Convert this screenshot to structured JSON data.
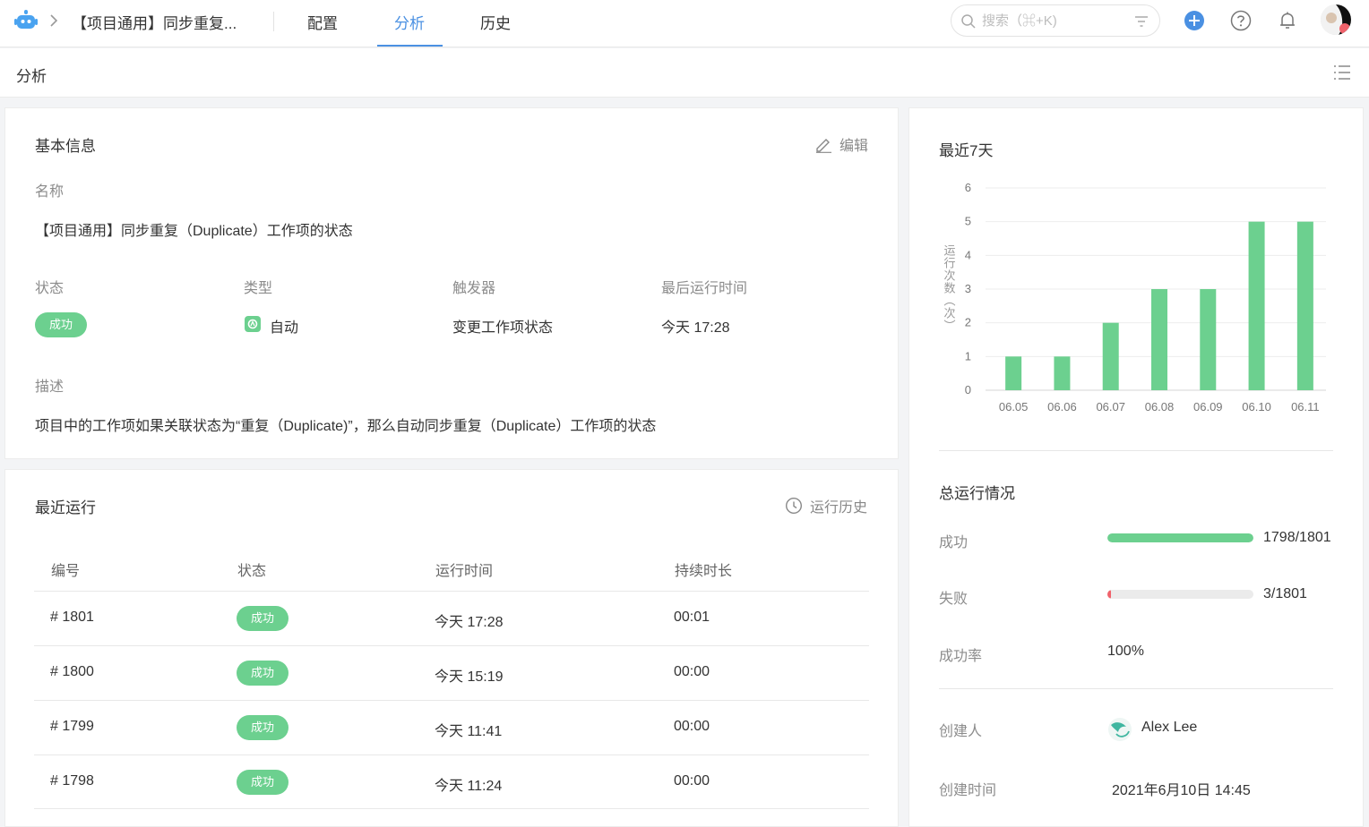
{
  "nav": {
    "project_title": "【项目通用】同步重复...",
    "tabs": [
      {
        "label": "配置"
      },
      {
        "label": "分析"
      },
      {
        "label": "历史"
      }
    ],
    "search_placeholder": "搜索（⌘+K)"
  },
  "subheader": {
    "title": "分析"
  },
  "basic_info": {
    "title": "基本信息",
    "edit_label": "编辑",
    "name_label": "名称",
    "name_value": "【项目通用】同步重复（Duplicate）工作项的状态",
    "status_label": "状态",
    "status_value": "成功",
    "type_label": "类型",
    "type_value": "自动",
    "trigger_label": "触发器",
    "trigger_value": "变更工作项状态",
    "last_run_label": "最后运行时间",
    "last_run_value": "今天 17:28",
    "desc_label": "描述",
    "desc_value": "项目中的工作项如果关联状态为“重复（Duplicate)”，那么自动同步重复（Duplicate）工作项的状态"
  },
  "recent_runs": {
    "title": "最近运行",
    "history_label": "运行历史",
    "columns": [
      "编号",
      "状态",
      "运行时间",
      "持续时长"
    ],
    "rows": [
      {
        "id": "# 1801",
        "status": "成功",
        "time": "今天 17:28",
        "duration": "00:01"
      },
      {
        "id": "# 1800",
        "status": "成功",
        "time": "今天 15:19",
        "duration": "00:00"
      },
      {
        "id": "# 1799",
        "status": "成功",
        "time": "今天 11:41",
        "duration": "00:00"
      },
      {
        "id": "# 1798",
        "status": "成功",
        "time": "今天 11:24",
        "duration": "00:00"
      }
    ]
  },
  "last7": {
    "title": "最近7天"
  },
  "chart_data": {
    "type": "bar",
    "categories": [
      "06.05",
      "06.06",
      "06.07",
      "06.08",
      "06.09",
      "06.10",
      "06.11"
    ],
    "values": [
      1,
      1,
      2,
      3,
      3,
      5,
      5
    ],
    "ylabel": "运行次数（次）",
    "yticks": [
      "0",
      "1",
      "2",
      "3",
      "4",
      "5",
      "6"
    ],
    "ylim": [
      0,
      6
    ],
    "grid": true,
    "color": "#6cd08f"
  },
  "summary": {
    "title": "总运行情况",
    "success_label": "成功",
    "success_value": "1798/1801",
    "success_fraction": 0.998,
    "fail_label": "失败",
    "fail_value": "3/1801",
    "fail_fraction": 0.002,
    "rate_label": "成功率",
    "rate_value": "100%",
    "creator_label": "创建人",
    "creator_value": "Alex Lee",
    "created_label": "创建时间",
    "created_value": "2021年6月10日 14:45"
  },
  "colors": {
    "accent": "#4a90e2",
    "success": "#6cd08f",
    "fail": "#f0626b"
  }
}
